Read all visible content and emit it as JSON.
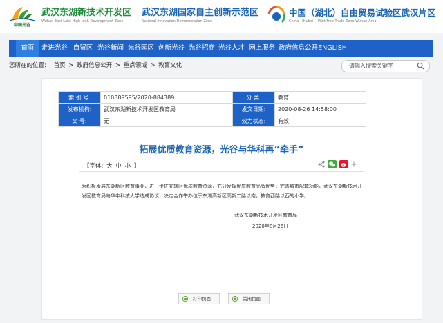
{
  "header": {
    "logo_text": "中国光谷",
    "brands": [
      {
        "cn": "武汉东湖新技术开发区",
        "en": "Wuhan East Lake High-tech Development Zone"
      },
      {
        "cn": "武汉东湖国家自主创新示范区",
        "en": "National Innovation Demonstration Zone"
      },
      {
        "cn": "中国（湖北）自由贸易试验区武汉片区",
        "en": "China （Hubei） Pilot Free Trade Zone Wuhan Area"
      }
    ]
  },
  "nav": [
    "首页",
    "走进光谷",
    "自贸区",
    "光谷新闻",
    "光谷园区",
    "创新光谷",
    "光谷招商",
    "光谷人才",
    "网上服务",
    "政府信息公开",
    "ENGLISH"
  ],
  "breadcrumb": {
    "label": "您所在的位置:",
    "items": [
      "首页",
      ">",
      "政府信息公开",
      ">",
      "重点领域",
      ">",
      "教育文化"
    ]
  },
  "search": {
    "placeholder": "请输入搜索关键字"
  },
  "meta": {
    "index_label": "索 引 号:",
    "index_value": "010889595/2020-884389",
    "category_label": "分    类:",
    "category_value": "教育",
    "publisher_label": "发布机构:",
    "publisher_value": "武汉东湖新技术开发区教育局",
    "date_label": "发文日期:",
    "date_value": "2020-08-26 14:58:00",
    "doc_label": "文    号:",
    "doc_value": "无",
    "status_label": "效力状态:",
    "status_value": "有效"
  },
  "article": {
    "title": "拓展优质教育资源，光谷与华科再“牵手”",
    "font_label": "【字体:",
    "font_sizes": [
      "大",
      "中",
      "小"
    ],
    "font_close": "】",
    "body": "为积极发展东湖新区教育事业，进一步扩充辖区优质教育资源，充分发挥优质教育品牌优势，完善城市配套功能，武汉东湖新技术开发区教育局与华中科技大学达成协议，决定合作举办位于东湖高新区高新二路以南，教育西路以西的小学。",
    "sign_org": "武汉东湖新技术开发区教育局",
    "sign_date": "2020年8月26日"
  },
  "buttons": {
    "print": "打印页面",
    "close": "关闭页面"
  },
  "colors": {
    "nav_blue": "#1e62c8",
    "title_blue": "#1a65b8",
    "brand_green": "#1f8a3a"
  }
}
